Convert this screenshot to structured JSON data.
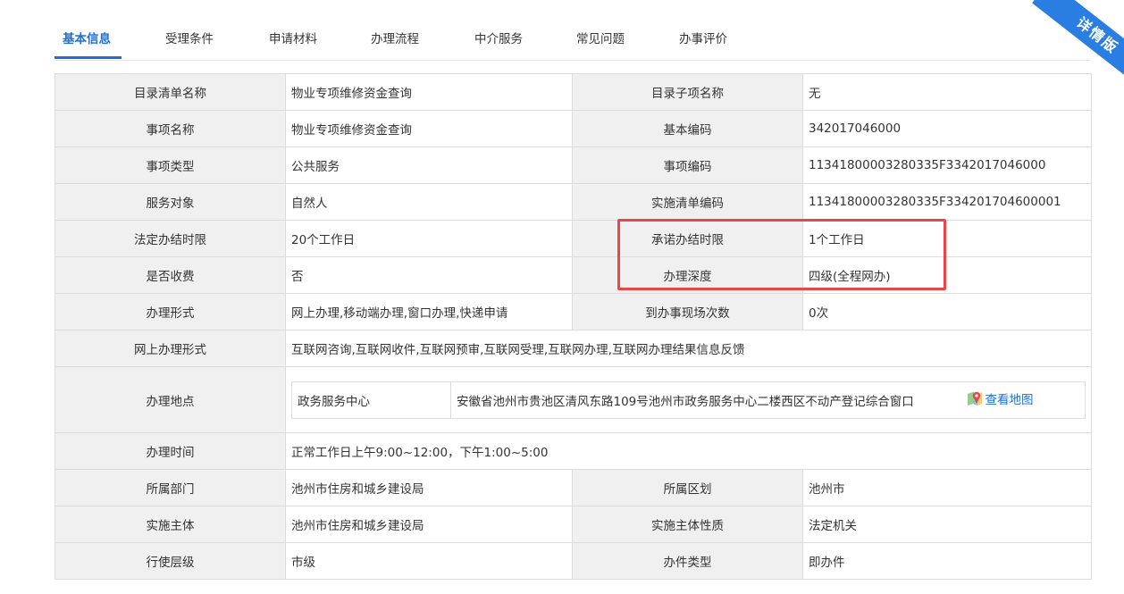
{
  "tabs": [
    {
      "label": "基本信息",
      "active": true
    },
    {
      "label": "受理条件",
      "active": false
    },
    {
      "label": "申请材料",
      "active": false
    },
    {
      "label": "办理流程",
      "active": false
    },
    {
      "label": "中介服务",
      "active": false
    },
    {
      "label": "常见问题",
      "active": false
    },
    {
      "label": "办事评价",
      "active": false
    }
  ],
  "ribbon": "详情版",
  "rows": {
    "r1": {
      "l1": "目录清单名称",
      "v1": "物业专项维修资金查询",
      "l2": "目录子项名称",
      "v2": "无"
    },
    "r2": {
      "l1": "事项名称",
      "v1": "物业专项维修资金查询",
      "l2": "基本编码",
      "v2": "342017046000"
    },
    "r3": {
      "l1": "事项类型",
      "v1": "公共服务",
      "l2": "事项编码",
      "v2": "11341800003280335F3342017046000"
    },
    "r4": {
      "l1": "服务对象",
      "v1": "自然人",
      "l2": "实施清单编码",
      "v2": "11341800003280335F334201704600001"
    },
    "r5": {
      "l1": "法定办结时限",
      "v1": "20个工作日",
      "l2": "承诺办结时限",
      "v2": "1个工作日"
    },
    "r6": {
      "l1": "是否收费",
      "v1": "否",
      "l2": "办理深度",
      "v2": "四级(全程网办)"
    },
    "r7": {
      "l1": "办理形式",
      "v1": "网上办理,移动端办理,窗口办理,快递申请",
      "l2": "到办事现场次数",
      "v2": "0次"
    },
    "r8": {
      "l1": "网上办理形式",
      "v1": "互联网咨询,互联网收件,互联网预审,互联网受理,互联网办理,互联网办理结果信息反馈"
    },
    "r9": {
      "l1": "办理地点",
      "place": "政务服务中心",
      "address": "安徽省池州市贵池区清风东路109号池州市政务服务中心二楼西区不动产登记综合窗口",
      "map_link": "查看地图"
    },
    "r10": {
      "l1": "办理时间",
      "v1": "正常工作日上午9:00~12:00，下午1:00~5:00"
    },
    "r11": {
      "l1": "所属部门",
      "v1": "池州市住房和城乡建设局",
      "l2": "所属区划",
      "v2": "池州市"
    },
    "r12": {
      "l1": "实施主体",
      "v1": "池州市住房和城乡建设局",
      "l2": "实施主体性质",
      "v2": "法定机关"
    },
    "r13": {
      "l1": "行使层级",
      "v1": "市级",
      "l2": "办件类型",
      "v2": "即办件"
    }
  },
  "colors": {
    "accent": "#1e6fd6",
    "label_bg": "#f0f0f0",
    "highlight": "#e8474a",
    "ribbon": "#2a7de1"
  },
  "icons": {
    "map": "map-pin-icon"
  }
}
